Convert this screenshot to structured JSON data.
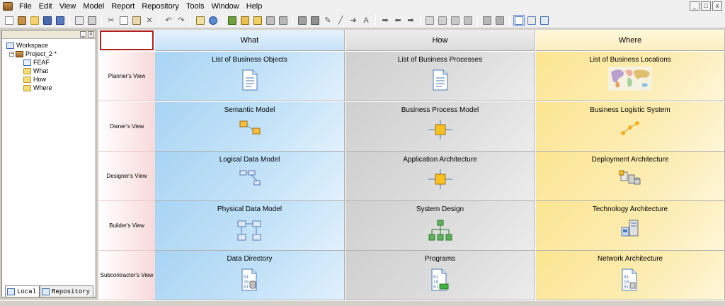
{
  "menu": {
    "items": [
      "File",
      "Edit",
      "View",
      "Model",
      "Report",
      "Repository",
      "Tools",
      "Window",
      "Help"
    ]
  },
  "window_controls": [
    "_",
    "□",
    "x"
  ],
  "toolbar": {
    "buttons": [
      "new",
      "open-project",
      "open",
      "save",
      "save-all",
      "print-preview",
      "print",
      "cut",
      "copy",
      "paste",
      "delete",
      "undo",
      "redo",
      "properties",
      "globe",
      "diagram1",
      "diagram2",
      "diagram3",
      "diagram4",
      "diagram5",
      "box",
      "shade",
      "pencil",
      "line",
      "arrow",
      "text",
      "shape1",
      "shape2",
      "shape3",
      "view1",
      "view2",
      "view3",
      "view4",
      "view5",
      "view6",
      "layout1",
      "layout2",
      "layout3"
    ]
  },
  "workspace": {
    "root": "Workspace",
    "project": "Project_2 *",
    "children": [
      "FEAF",
      "What",
      "How",
      "Where"
    ]
  },
  "panel_tabs": {
    "local": "Local",
    "repository": "Repository"
  },
  "grid": {
    "columns": [
      "What",
      "How",
      "Where"
    ],
    "rows": [
      "Planner's View",
      "Owner's View",
      "Designer's View",
      "Builder's View",
      "Subcontractor's View"
    ],
    "cells": [
      [
        "List of Business Objects",
        "List of Business Processes",
        "List of Business Locations"
      ],
      [
        "Semantic Model",
        "Business Process Model",
        "Business Logistic System"
      ],
      [
        "Logical Data Model",
        "Application Architecture",
        "Deployment Architecture"
      ],
      [
        "Physical Data Model",
        "System Design",
        "Technology Architecture"
      ],
      [
        "Data Directory",
        "Programs",
        "Network Architecture"
      ]
    ],
    "cell_icons": [
      [
        "document-icon",
        "document-icon",
        "world-map-icon"
      ],
      [
        "entity-link-icon",
        "process-box-icon",
        "logistic-nodes-icon"
      ],
      [
        "table-relation-icon",
        "process-box-icon",
        "deployment-icon"
      ],
      [
        "table-grid-icon",
        "hierarchy-icon",
        "server-icon"
      ],
      [
        "data-file-icon",
        "program-file-icon",
        "network-file-icon"
      ]
    ],
    "colors": {
      "what_header": "#c8e2f8",
      "how_header": "#dcdcdc",
      "where_header": "#fbeec0",
      "what_cell": "#a8d4f4",
      "how_cell": "#cfcfcf",
      "where_cell": "#fbe592",
      "corner_border": "#b02020"
    }
  }
}
